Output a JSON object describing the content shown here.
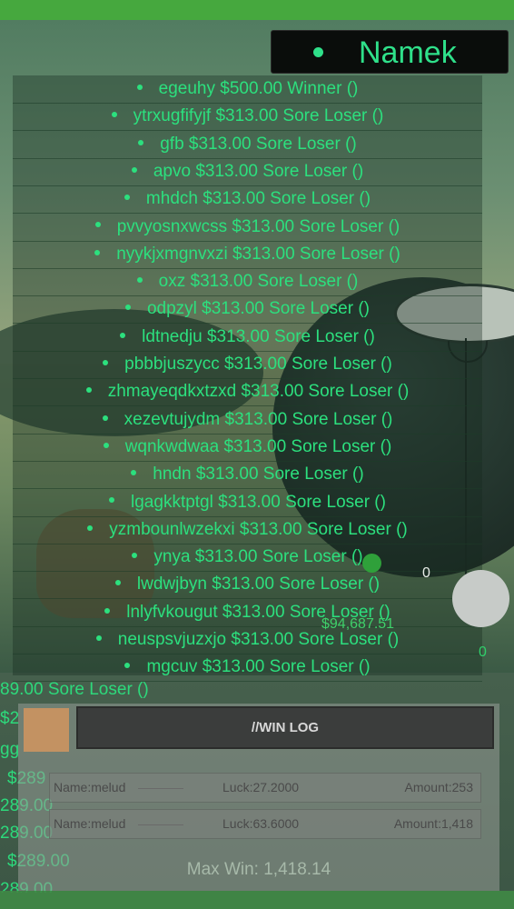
{
  "header": {
    "server_name": "Namek"
  },
  "leaderboard": [
    {
      "text": "egeuhy $500.00 Winner ()"
    },
    {
      "text": "ytrxugfifyjf $313.00 Sore Loser ()"
    },
    {
      "text": "gfb $313.00 Sore Loser ()"
    },
    {
      "text": "apvo $313.00 Sore Loser ()"
    },
    {
      "text": "mhdch $313.00 Sore Loser ()"
    },
    {
      "text": "pvvyosnxwcss $313.00 Sore Loser ()"
    },
    {
      "text": "nyykjxmgnvxzi $313.00 Sore Loser ()"
    },
    {
      "text": "oxz $313.00 Sore Loser ()"
    },
    {
      "text": "odpzyl $313.00 Sore Loser ()"
    },
    {
      "text": "ldtnedju $313.00 Sore Loser ()"
    },
    {
      "text": "pbbbjuszycc $313.00 Sore Loser ()"
    },
    {
      "text": "zhmayeqdkxtzxd $313.00 Sore Loser ()"
    },
    {
      "text": "xezevtujydm $313.00 Sore Loser ()"
    },
    {
      "text": "wqnkwdwaa $313.00 Sore Loser ()"
    },
    {
      "text": "hndn $313.00 Sore Loser ()"
    },
    {
      "text": "lgagkktptgl $313.00 Sore Loser ()"
    },
    {
      "text": "yzmbounlwzekxi $313.00 Sore Loser ()"
    },
    {
      "text": "ynya $313.00 Sore Loser ()"
    },
    {
      "text": "lwdwjbyn $313.00 Sore Loser ()"
    },
    {
      "text": "lnlyfvkougut $313.00 Sore Loser ()"
    },
    {
      "text": "neuspsvjuzxjo $313.00 Sore Loser ()"
    },
    {
      "text": "mgcuv $313.00 Sore Loser ()"
    }
  ],
  "background_entries": [
    "89.00 Sore Loser ()",
    "$2",
    "gg",
    "$289",
    "289.00",
    "289.00",
    "$289.00",
    "289.00"
  ],
  "hud": {
    "count_top": "0",
    "count_bottom": "0",
    "balance": "$94,687.51"
  },
  "win_log": {
    "title": "//WIN LOG",
    "rows": [
      {
        "name": "Name:melud",
        "luck": "Luck:27.2000",
        "amount": "Amount:253"
      },
      {
        "name": "Name:melud",
        "luck": "Luck:63.6000",
        "amount": "Amount:1,418"
      }
    ],
    "max_win": "Max Win: 1,418.14"
  },
  "colors": {
    "accent": "#2ce07e",
    "topbar": "#46a83e"
  }
}
